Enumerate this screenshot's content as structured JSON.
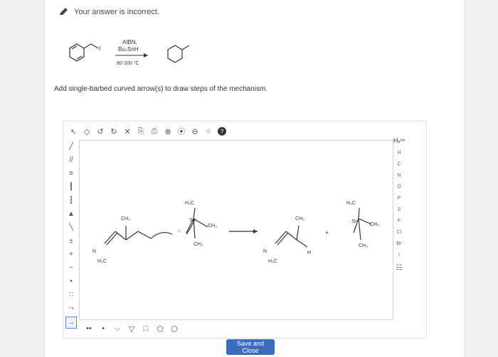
{
  "banner": {
    "text": "Your answer is incorrect."
  },
  "reaction": {
    "reagent_line1": "AIBN,",
    "reagent_line2": "Bu₃SnH",
    "conditions": "80-100 °C"
  },
  "prompt": "Add single-barbed curved arrow(s) to draw steps of the mechanism.",
  "toolbar": {
    "tools": [
      "select-icon",
      "eraser-icon",
      "undo-icon",
      "redo-icon",
      "delete-icon",
      "copy-icon",
      "paste-icon",
      "zoom-in-icon",
      "zoom-fit-icon",
      "zoom-out-icon",
      "zoom-reset-icon",
      "help-icon"
    ],
    "glyphs": [
      "➴",
      "◇",
      "↺",
      "↻",
      "✕",
      "⎘",
      "⎙",
      "⊕",
      "⦿",
      "⊖",
      "○",
      "?"
    ]
  },
  "left_tools": {
    "tools": [
      "single-bond-tool",
      "double-bond-tool",
      "triple-bond-tool",
      "bold-bond-tool",
      "hash-bond-tool",
      "wedge-bond-tool",
      "plain-line-tool",
      "charge-tool",
      "plus-tool",
      "minus-tool",
      "radical-tool",
      "lone-pair-tool",
      "curved-arrow-tool",
      "arrow-tool"
    ],
    "glyphs": [
      "╱",
      "//",
      "≡",
      "┃",
      "┇",
      "▲",
      "╲",
      "±",
      "+",
      "−",
      "•",
      "∷",
      "⤳",
      "→"
    ]
  },
  "periodic": {
    "exp_label": "Hₓᶜⁿ",
    "elements": [
      "H",
      "C",
      "N",
      "O",
      "P",
      "S",
      "F",
      "Cl",
      "Br",
      "I"
    ],
    "table_icon": "☷"
  },
  "bottom_tools": {
    "tools": [
      "dots-icon",
      "dot-icon",
      "bracket-icon",
      "ring-3-icon",
      "ring-4-icon",
      "ring-5-icon",
      "ring-6-icon"
    ],
    "glyphs": [
      "••",
      "•",
      "⌵",
      "▽",
      "□",
      "⬠",
      "⬡"
    ]
  },
  "canvas_labels": {
    "ch3": "CH₃",
    "h3c": "H₃C",
    "n": "N",
    "sn": "Sn",
    "h": "H",
    "plus": "+",
    "dot_sn": "·Sn"
  },
  "save_button": "Save and Close"
}
